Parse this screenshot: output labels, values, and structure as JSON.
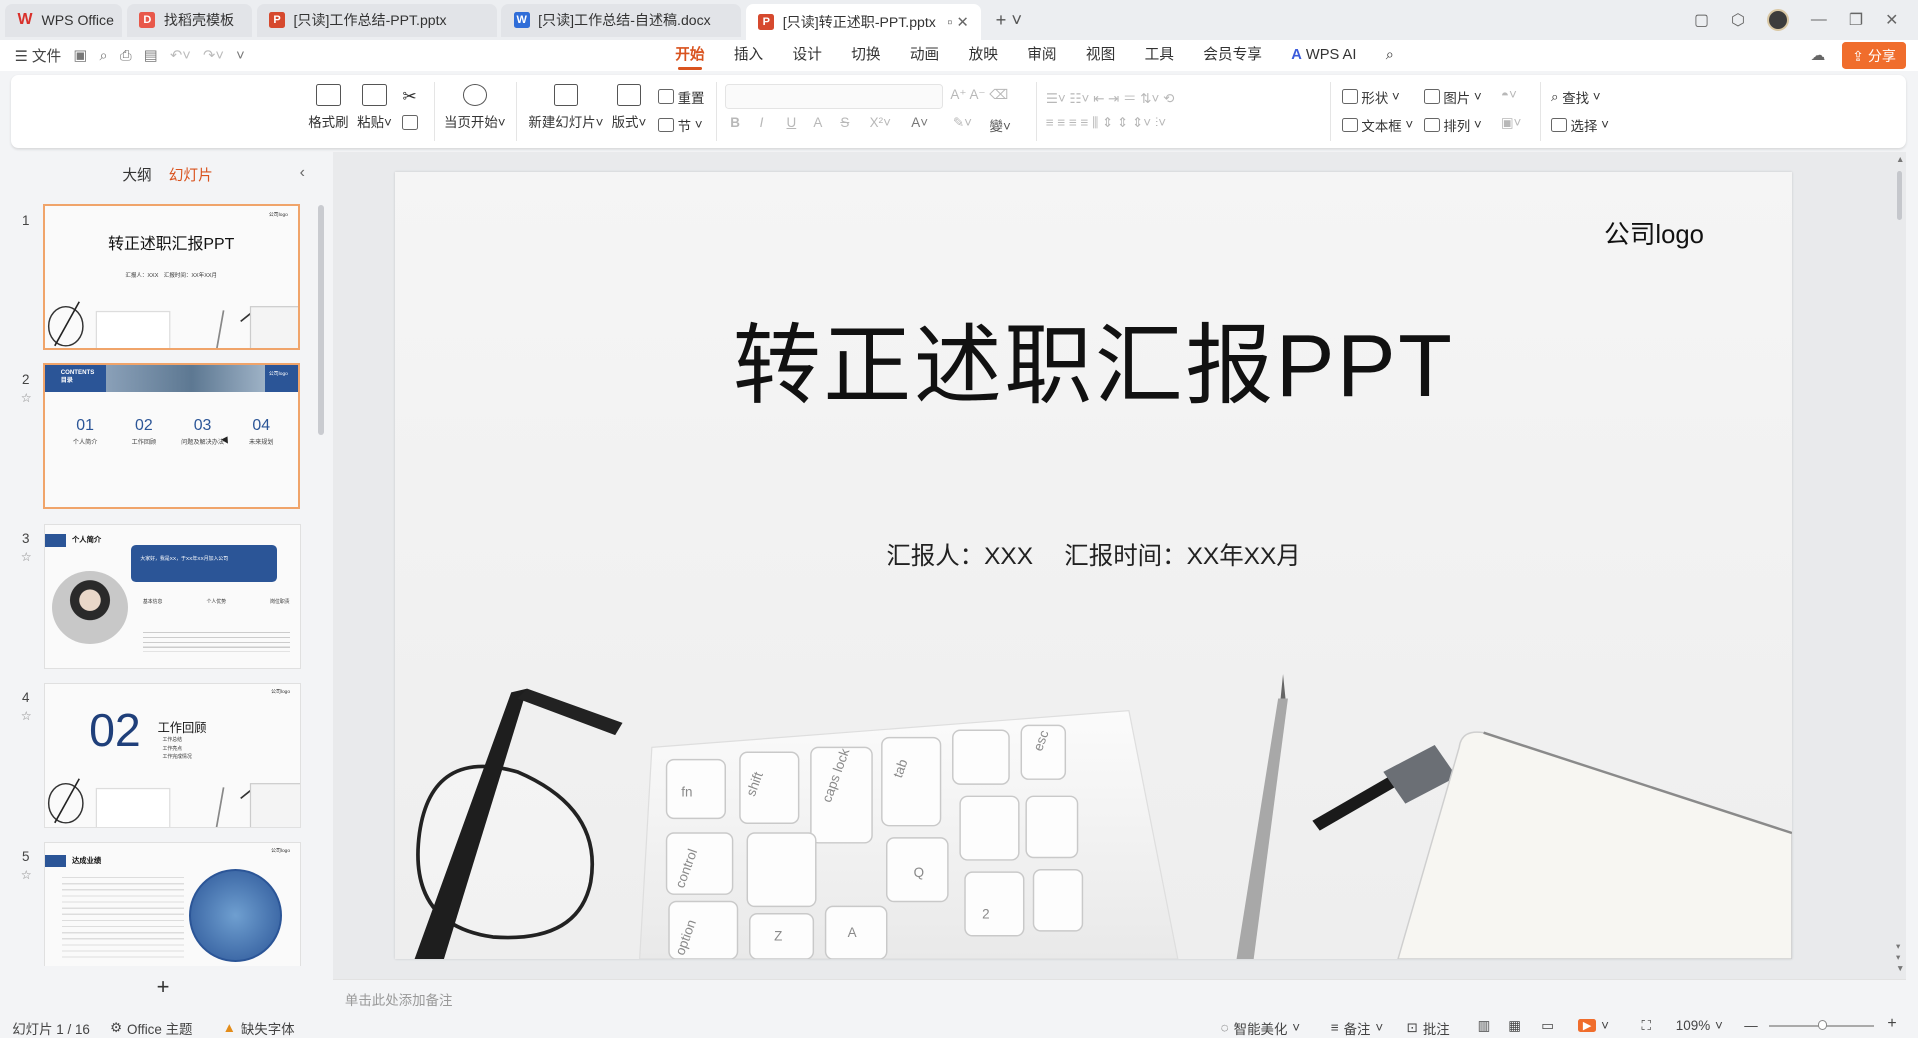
{
  "tabs": [
    {
      "label": "WPS Office",
      "icon": "wps-logo-icon",
      "active": false
    },
    {
      "label": "找稻壳模板",
      "icon": "docer-icon",
      "active": false
    },
    {
      "label": "[只读]工作总结-PPT.pptx",
      "icon": "ppt-file-icon",
      "active": false
    },
    {
      "label": "[只读]工作总结-自述稿.docx",
      "icon": "word-file-icon",
      "active": false
    },
    {
      "label": "[只读]转正述职-PPT.pptx",
      "icon": "ppt-file-icon",
      "active": true
    }
  ],
  "menu": {
    "file_label": "文件",
    "tabs": [
      "开始",
      "插入",
      "设计",
      "切换",
      "动画",
      "放映",
      "审阅",
      "视图",
      "工具",
      "会员专享"
    ],
    "active_tab": "开始",
    "wps_ai": "WPS AI",
    "share": "分享"
  },
  "ribbon": {
    "format_painter": "格式刷",
    "paste": "粘贴",
    "play_from_current": "当页开始",
    "new_slide": "新建幻灯片",
    "layout": "版式",
    "section": "节",
    "reset": "重置",
    "shape": "形状",
    "picture": "图片",
    "textbox": "文本框",
    "arrange": "排列",
    "find": "查找",
    "select": "选择"
  },
  "panel": {
    "outline_tab": "大纲",
    "slides_tab": "幻灯片",
    "thumbs": [
      {
        "num": "1",
        "title": "转正述职汇报PPT",
        "sub": "汇报人：XXX　汇报时间：XX年XX月",
        "logo": "公司logo"
      },
      {
        "num": "2",
        "header_en": "CONTENTS",
        "header_cn": "目录",
        "logo": "公司logo",
        "items": [
          {
            "n": "01",
            "t": "个人简介"
          },
          {
            "n": "02",
            "t": "工作回顾"
          },
          {
            "n": "03",
            "t": "问题及解决办法"
          },
          {
            "n": "04",
            "t": "未来规划"
          }
        ]
      },
      {
        "num": "3",
        "title": "个人简介",
        "quote": "大家好，我是XX，于XX年XX月加入公司",
        "c1": "基本信息",
        "c2": "个人优势",
        "c3": "岗位职责"
      },
      {
        "num": "4",
        "big": "02",
        "title": "工作回顾",
        "logo": "公司logo",
        "l1": "工作总结",
        "l2": "工作亮点",
        "l3": "工作完成情况"
      },
      {
        "num": "5",
        "title": "达成业绩",
        "logo": "公司logo"
      }
    ]
  },
  "slide": {
    "logo": "公司logo",
    "title": "转正述职汇报PPT",
    "subtitle": "汇报人：XXX　 汇报时间：XX年XX月"
  },
  "notes_placeholder": "单击此处添加备注",
  "status": {
    "slide_counter": "幻灯片 1 / 16",
    "theme": "Office 主题",
    "missing_font": "缺失字体",
    "beautify": "智能美化",
    "notes": "备注",
    "comments": "批注",
    "zoom": "109%"
  },
  "colors": {
    "accent": "#d9531e",
    "share": "#f06d2c",
    "thumb_blue": "#2b5597"
  }
}
